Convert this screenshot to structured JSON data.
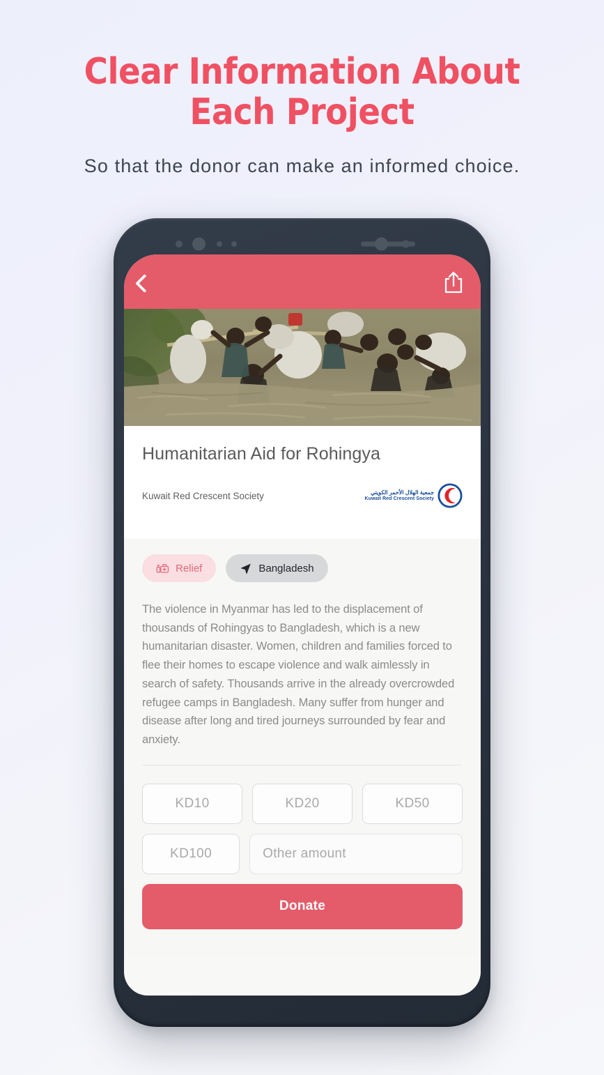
{
  "promo": {
    "headline": "Clear Information About\nEach Project",
    "subheadline": "So that the donor can make an informed choice.",
    "headline_color": "#ef5163",
    "subheadline_color": "#3e4552"
  },
  "phone": {
    "frame_color": "#2b3440",
    "accent_color": "#e45b69"
  },
  "appbar": {
    "back_icon": "chevron-left-icon",
    "share_icon": "share-icon"
  },
  "hero": {
    "alt": "Refugees wading through flood water carrying bundles"
  },
  "project": {
    "title": "Humanitarian Aid for Rohingya",
    "organization": "Kuwait Red Crescent Society",
    "logo": {
      "arabic": "جمعية الهلال الأحمر الكويتي",
      "english": "Kuwait Red Crescent Society",
      "color": "#1b4f9c",
      "crescent_color": "#e1232b"
    },
    "chips": [
      {
        "label": "Relief",
        "icon": "first-aid-kit-icon",
        "bg": "#fadee2",
        "fg": "#e3697a"
      },
      {
        "label": "Bangladesh",
        "icon": "navigation-arrow-icon",
        "bg": "#d7d8da",
        "fg": "#22262c"
      }
    ],
    "description": "The violence in Myanmar has led to the displacement of thousands of Rohingyas to Bangladesh, which is a new humanitarian disaster. Women, children and families forced to flee their homes to escape violence and walk aimlessly in search of safety. Thousands arrive in the already overcrowded refugee camps in Bangladesh. Many suffer from hunger and disease after long and tired journeys surrounded by fear and anxiety."
  },
  "donation": {
    "amounts_row1": [
      "KD10",
      "KD20",
      "KD50"
    ],
    "amounts_row2": [
      "KD100"
    ],
    "other_placeholder": "Other amount",
    "other_value": "",
    "donate_label": "Donate"
  }
}
